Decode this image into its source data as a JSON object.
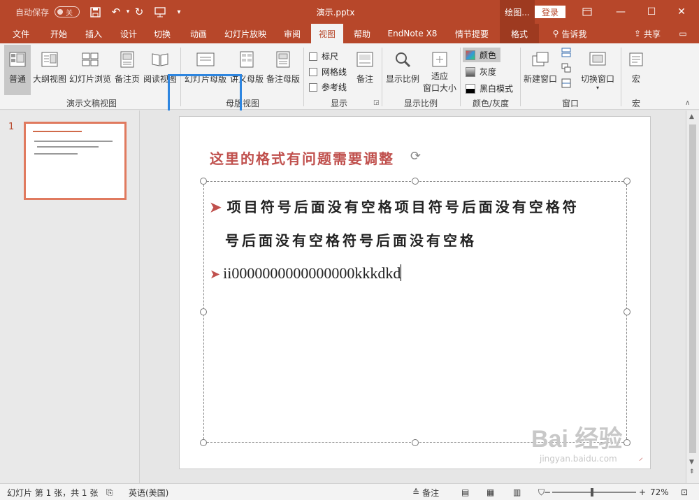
{
  "titlebar": {
    "autosave_label": "自动保存",
    "autosave_toggle": "关",
    "doc_title": "演示.pptx",
    "context_label": "绘图...",
    "login": "登录"
  },
  "tabs": [
    {
      "label": "文件"
    },
    {
      "label": "开始"
    },
    {
      "label": "插入"
    },
    {
      "label": "设计"
    },
    {
      "label": "切换"
    },
    {
      "label": "动画"
    },
    {
      "label": "幻灯片放映"
    },
    {
      "label": "审阅"
    },
    {
      "label": "视图"
    },
    {
      "label": "帮助"
    },
    {
      "label": "EndNote X8"
    },
    {
      "label": "情节提要"
    },
    {
      "label": "格式"
    }
  ],
  "tellme": "告诉我",
  "share": "共享",
  "ribbon": {
    "presentation_views": {
      "normal": "普通",
      "outline": "大纲视图",
      "sorter": "幻灯片浏览",
      "notes_page": "备注页",
      "reading": "阅读视图",
      "group": "演示文稿视图"
    },
    "master_views": {
      "slide_master": "幻灯片母版",
      "handout_master": "讲义母版",
      "notes_master": "备注母版",
      "group": "母版视图"
    },
    "show": {
      "ruler": "标尺",
      "gridlines": "网格线",
      "guides": "参考线",
      "notes": "备注",
      "group": "显示"
    },
    "zoom": {
      "zoom": "显示比例",
      "fit_line1": "适应",
      "fit_line2": "窗口大小",
      "group": "显示比例"
    },
    "color": {
      "color": "颜色",
      "grayscale": "灰度",
      "bw": "黑白模式",
      "group": "颜色/灰度"
    },
    "window": {
      "new_window": "新建窗口",
      "switch": "切换窗口",
      "group": "窗口"
    },
    "macros": {
      "macro": "宏",
      "group": "宏"
    }
  },
  "thumbnail": {
    "number": "1"
  },
  "slide": {
    "title": "这里的格式有问题需要调整",
    "bullet1_line1": "项目符号后面没有空格项目符号后面没有空格符",
    "bullet1_line2": "号后面没有空格符号后面没有空格",
    "bullet2": "ii0000000000000000kkkdkd"
  },
  "status": {
    "slide_info": "幻灯片 第 1 张，共 1 张",
    "language": "英语(美国)",
    "notes": "备注",
    "zoom": "72%"
  },
  "watermark": {
    "brand": "Bai 经验",
    "url": "jingyan.baidu.com"
  }
}
